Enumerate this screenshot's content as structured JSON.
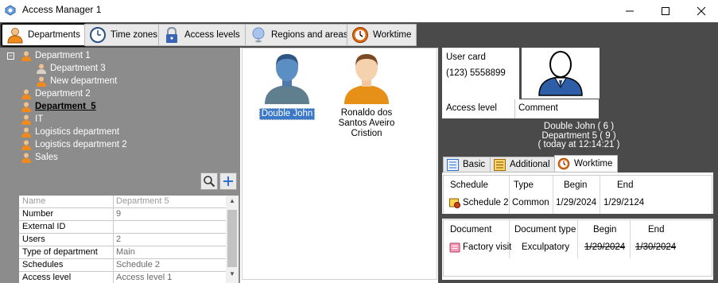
{
  "window": {
    "title": "Access Manager 1"
  },
  "tabs": [
    {
      "label": "Departments",
      "icon": "department-person-icon",
      "active": true
    },
    {
      "label": "Time zones",
      "icon": "clock-icon",
      "active": false
    },
    {
      "label": "Access levels",
      "icon": "padlock-icon",
      "active": false
    },
    {
      "label": "Regions and areas",
      "icon": "region-pin-icon",
      "active": false
    },
    {
      "label": "Worktime",
      "icon": "worktime-clock-icon",
      "active": false
    }
  ],
  "tree": {
    "expander": "−",
    "items": [
      {
        "label": "Department 1",
        "level": 0,
        "selected": false
      },
      {
        "label": "Department 3",
        "level": 1,
        "selected": false
      },
      {
        "label": "New department",
        "level": 1,
        "selected": false
      },
      {
        "label": "Department 2",
        "level": 0,
        "selected": false
      },
      {
        "label": "Department_5",
        "level": 0,
        "selected": true
      },
      {
        "label": "IT",
        "level": 0,
        "selected": false
      },
      {
        "label": "Logistics department",
        "level": 0,
        "selected": false
      },
      {
        "label": "Logistics department 2",
        "level": 0,
        "selected": false
      },
      {
        "label": "Sales",
        "level": 0,
        "selected": false
      }
    ]
  },
  "toolbar": {
    "search_icon": "magnifier-icon",
    "add_icon": "plus-icon"
  },
  "properties": [
    {
      "name": "Name",
      "value": "Department 5",
      "disabled": true
    },
    {
      "name": "Number",
      "value": "9",
      "disabled": false
    },
    {
      "name": "External ID",
      "value": "",
      "disabled": false
    },
    {
      "name": "Users",
      "value": "2",
      "disabled": false
    },
    {
      "name": "Type of department",
      "value": "Main",
      "disabled": false
    },
    {
      "name": "Schedules",
      "value": "Schedule 2",
      "disabled": false
    },
    {
      "name": "Access level",
      "value": "Access level 1",
      "disabled": false
    }
  ],
  "people": [
    {
      "name": "Double John",
      "selected": true,
      "avatar": "blue-person-avatar"
    },
    {
      "name": "Ronaldo dos Santos Aveiro Cristion",
      "selected": false,
      "avatar": "orange-person-avatar"
    }
  ],
  "details": {
    "user_card_label": "User card",
    "user_card_value": "(123) 5558899",
    "access_level_header": "Access level",
    "comment_header": "Comment",
    "info_line1": "Double John ( 6 )",
    "info_line2": "Department 5 ( 9 )",
    "info_line3": "( today at 12:14:21 )"
  },
  "sub_tabs": [
    {
      "label": "Basic",
      "icon": "list-icon",
      "active": false
    },
    {
      "label": "Additional",
      "icon": "list-yellow-icon",
      "active": false
    },
    {
      "label": "Worktime",
      "icon": "worktime-clock-icon",
      "active": true
    }
  ],
  "schedule_table": {
    "headers": [
      "Schedule",
      "Type",
      "Begin",
      "End"
    ],
    "rows": [
      {
        "schedule": "Schedule 2",
        "type": "Common",
        "begin": "1/29/2024",
        "end": "1/29/2124"
      }
    ]
  },
  "document_table": {
    "headers": [
      "Document",
      "Document type",
      "Begin",
      "End"
    ],
    "rows": [
      {
        "document": "Factory visit",
        "type": "Exculpatory",
        "begin": "1/29/2024",
        "end": "1/30/2024"
      }
    ]
  },
  "colors": {
    "dark_bg": "#4a4a4a",
    "tree_bg": "#8c8c8c",
    "selection": "#3b79c8"
  }
}
